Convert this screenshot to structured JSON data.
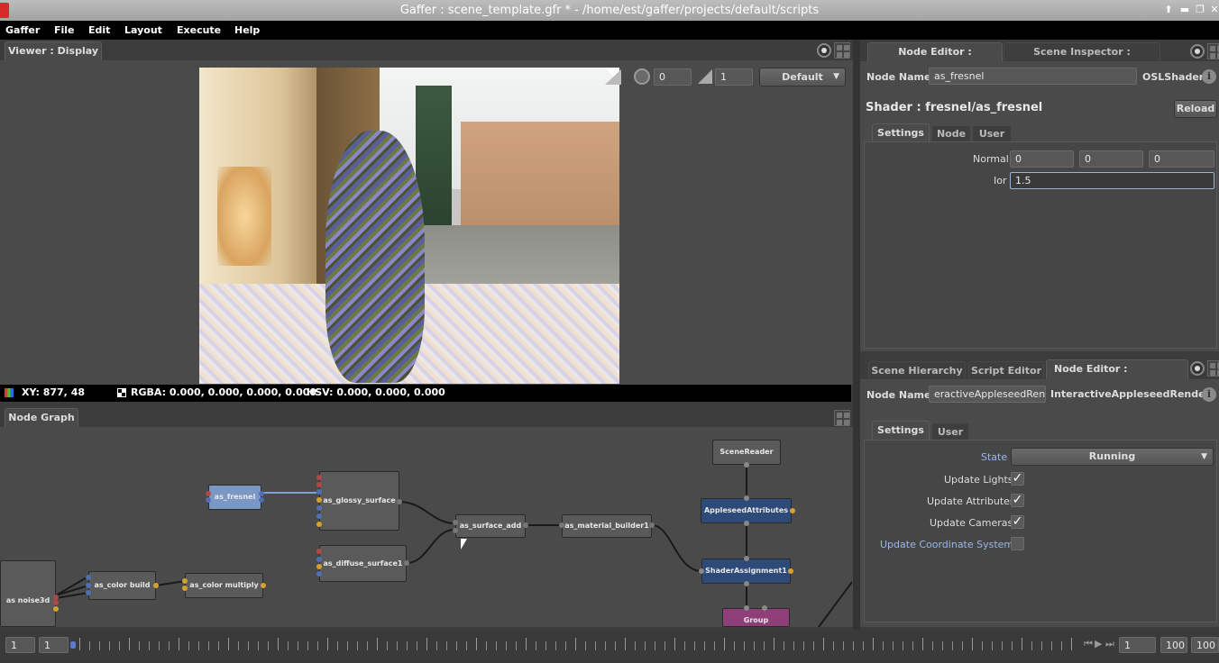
{
  "window": {
    "title": "Gaffer : scene_template.gfr * - /home/est/gaffer/projects/default/scripts"
  },
  "menu": {
    "items": [
      "Gaffer",
      "File",
      "Edit",
      "Layout",
      "Execute",
      "Help"
    ]
  },
  "viewer": {
    "tab": "Viewer : Display",
    "exposure": "0",
    "gamma": "1",
    "display_mode": "Default",
    "status_xy": "XY: 877, 48",
    "status_rgba": "RGBA: 0.000, 0.000, 0.000, 0.000",
    "status_hsv": "HSV: 0.000, 0.000, 0.000"
  },
  "node_graph": {
    "tab": "Node Graph",
    "nodes": {
      "as_fresnel": "as_fresnel",
      "as_glossy": "as_glossy_surface",
      "as_diffuse": "as_diffuse_surface1",
      "as_surface_add": "as_surface_add",
      "as_material_builder": "as_material_builder1",
      "as_color_build": "as_color build",
      "as_color_multiply": "as_color multiply",
      "as_noise": "as noise3d",
      "scene_reader": "SceneReader",
      "appleseed_attributes": "AppleseedAttributes",
      "shader_assignment": "ShaderAssignment1",
      "group": "Group"
    },
    "colors": {
      "shader_node": "#5a5a5a",
      "selected_node": "#7b98c4",
      "scene_node": "#2e4a78",
      "group_node": "#8f3f78"
    }
  },
  "node_editor_top": {
    "tabs": [
      "Node Editor : as_fresnel",
      "Scene Inspector : as_fresnel"
    ],
    "node_name_label": "Node Name",
    "node_name": "as_fresnel",
    "node_type": "OSLShader",
    "shader_title": "Shader : fresnel/as_fresnel",
    "reload": "Reload",
    "sub_tabs": [
      "Settings",
      "Node",
      "User"
    ],
    "normal_label": "Normal",
    "normal": [
      "0",
      "0",
      "0"
    ],
    "ior_label": "Ior",
    "ior": "1.5"
  },
  "node_editor_bottom": {
    "tabs": [
      "Scene Hierarchy",
      "Script Editor",
      "Node Editor : InteractiveAp"
    ],
    "node_name_label": "Node Name",
    "node_name": "eractiveAppleseedRender",
    "node_type": "InteractiveAppleseedRender",
    "sub_tabs": [
      "Settings",
      "User"
    ],
    "state_label": "State",
    "state": "Running",
    "update_lights": "Update Lights",
    "update_attributes": "Update Attributes",
    "update_cameras": "Update Cameras",
    "update_coord": "Update Coordinate Systems",
    "checks": {
      "lights": true,
      "attributes": true,
      "cameras": true,
      "coord": false
    }
  },
  "timeline": {
    "start": "1",
    "current": "1",
    "frame": "1",
    "end1": "100",
    "end2": "100"
  }
}
